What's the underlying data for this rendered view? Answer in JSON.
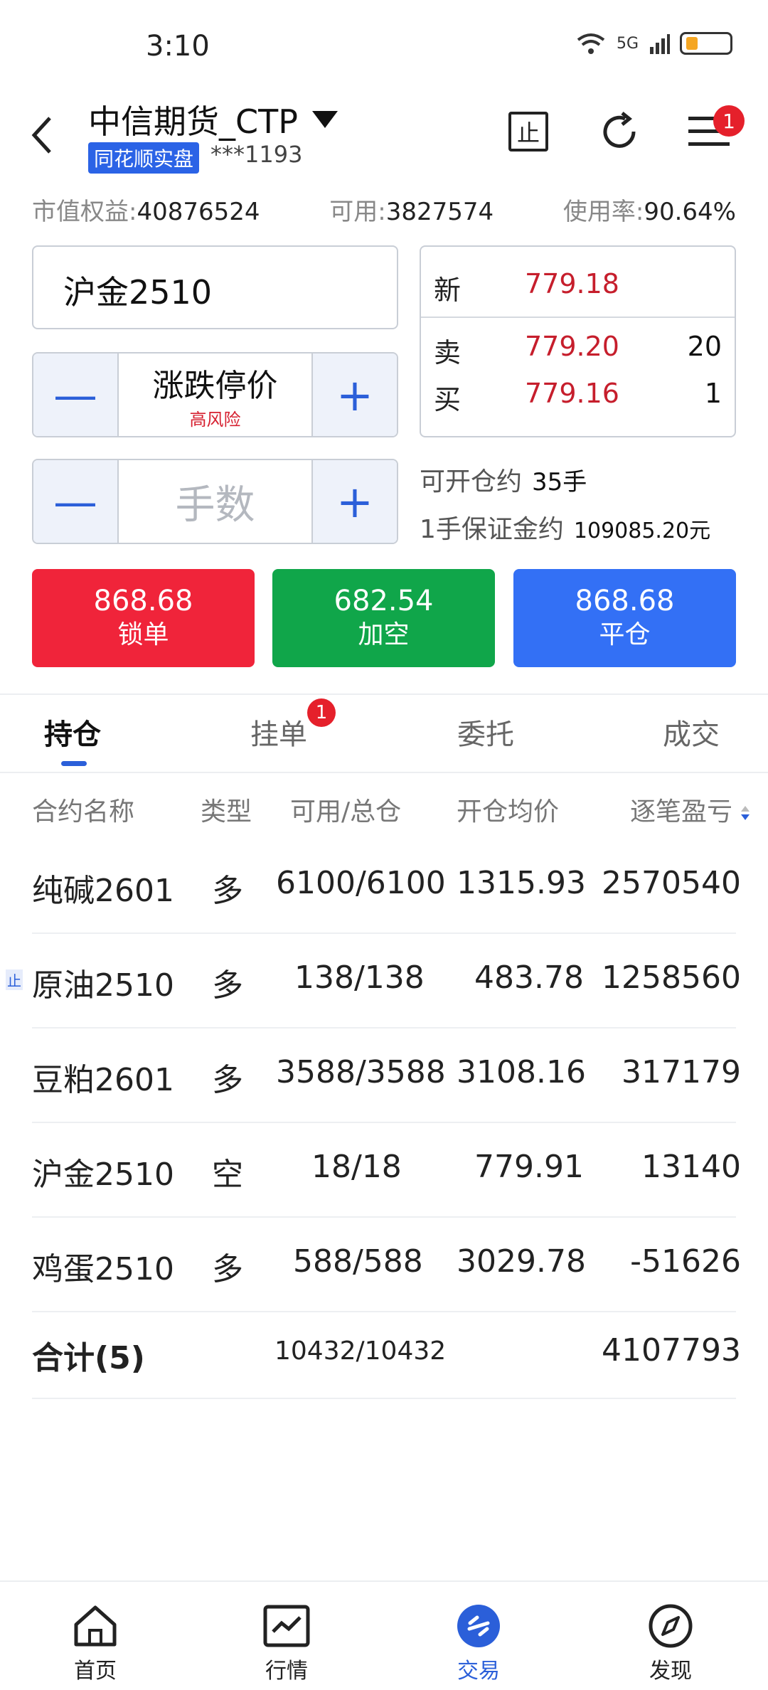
{
  "status": {
    "time": "3:10",
    "signal": "5G"
  },
  "header": {
    "account_name": "中信期货_CTP",
    "live_badge": "同花顺实盘",
    "account_no": "***1193",
    "notif_count": "1",
    "stop_icon_label": "止"
  },
  "funds": {
    "equity_label": "市值权益:",
    "equity_value": "40876524",
    "avail_label": "可用:",
    "avail_value": "3827574",
    "usage_label": "使用率:",
    "usage_value": "90.64%"
  },
  "order": {
    "symbol": "沪金2510",
    "price_label": "涨跌停价",
    "risk_label": "高风险",
    "qty_placeholder": "手数",
    "minus": "—",
    "plus": "+",
    "can_open_label": "可开仓约",
    "can_open_value": "35手",
    "margin_label": "1手保证金约",
    "margin_value": "109085.20元"
  },
  "quote": {
    "last_label": "新",
    "last_price": "779.18",
    "ask_label": "卖",
    "ask_price": "779.20",
    "ask_vol": "20",
    "bid_label": "买",
    "bid_price": "779.16",
    "bid_vol": "1"
  },
  "actions": [
    {
      "price": "868.68",
      "name": "锁单",
      "color": "#f0243a"
    },
    {
      "price": "682.54",
      "name": "加空",
      "color": "#10a64a"
    },
    {
      "price": "868.68",
      "name": "平仓",
      "color": "#3370f5"
    }
  ],
  "tabs": {
    "positions": "持仓",
    "pending": "挂单",
    "pending_badge": "1",
    "orders": "委托",
    "trades": "成交"
  },
  "table": {
    "headers": {
      "name": "合约名称",
      "type": "类型",
      "qty": "可用/总仓",
      "avg": "开仓均价",
      "pnl": "逐笔盈亏"
    },
    "rows": [
      {
        "name": "纯碱2601",
        "type": "多",
        "qty": "6100/6100",
        "avg": "1315.93",
        "pnl": "2570540"
      },
      {
        "name": "原油2510",
        "type": "多",
        "qty": "138/138",
        "avg": "483.78",
        "pnl": "1258560",
        "tag": "止"
      },
      {
        "name": "豆粕2601",
        "type": "多",
        "qty": "3588/3588",
        "avg": "3108.16",
        "pnl": "317179"
      },
      {
        "name": "沪金2510",
        "type": "空",
        "qty": "18/18",
        "avg": "779.91",
        "pnl": "13140"
      },
      {
        "name": "鸡蛋2510",
        "type": "多",
        "qty": "588/588",
        "avg": "3029.78",
        "pnl": "-51626"
      }
    ],
    "total": {
      "label": "合计(5)",
      "qty": "10432/10432",
      "pnl": "4107793"
    }
  },
  "nav": {
    "home": "首页",
    "market": "行情",
    "trade": "交易",
    "discover": "发现"
  }
}
